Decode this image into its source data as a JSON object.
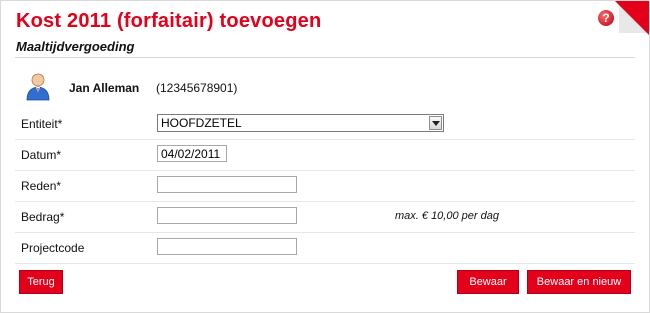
{
  "header": {
    "title": "Kost 2011 (forfaitair) toevoegen",
    "subtitle": "Maaltijdvergoeding",
    "help_icon": "?"
  },
  "user": {
    "avatar_icon": "user-icon",
    "name": "Jan Alleman",
    "id": "(12345678901)"
  },
  "form": {
    "entiteit": {
      "label": "Entiteit*",
      "value": "HOOFDZETEL"
    },
    "datum": {
      "label": "Datum*",
      "value": "04/02/2011"
    },
    "reden": {
      "label": "Reden*",
      "value": ""
    },
    "bedrag": {
      "label": "Bedrag*",
      "value": "",
      "hint": "max. € 10,00 per dag"
    },
    "projectcode": {
      "label": "Projectcode",
      "value": ""
    }
  },
  "buttons": {
    "back": "Terug",
    "save": "Bewaar",
    "save_new": "Bewaar en nieuw"
  },
  "colors": {
    "accent": "#e2001a"
  }
}
